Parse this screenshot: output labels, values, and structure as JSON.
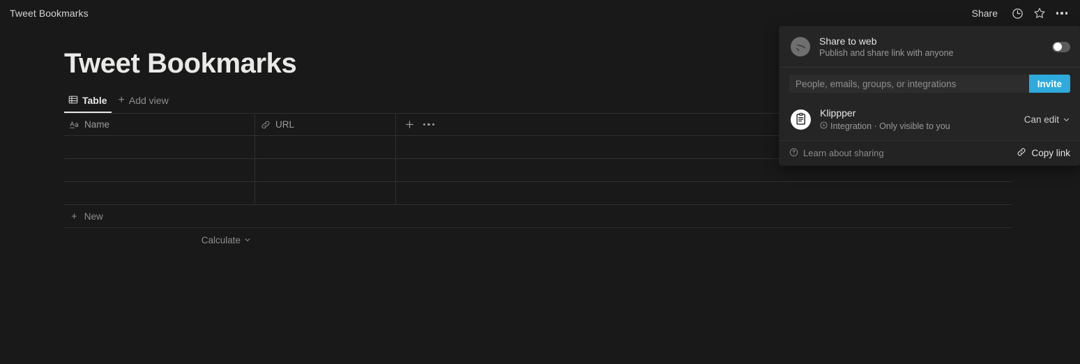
{
  "topbar": {
    "breadcrumb": "Tweet Bookmarks",
    "share_label": "Share",
    "history_icon": "clock-icon",
    "favorite_icon": "star-icon",
    "more_icon": "ellipsis-icon"
  },
  "page": {
    "title": "Tweet Bookmarks",
    "tabs": [
      {
        "label": "Table",
        "icon": "table-icon",
        "active": true
      },
      {
        "label": "Add view",
        "icon": "plus-icon",
        "active": false
      }
    ]
  },
  "table": {
    "columns": [
      {
        "label": "Name",
        "icon": "text-type-icon"
      },
      {
        "label": "URL",
        "icon": "link-type-icon"
      }
    ],
    "add_column_label": "+",
    "more_columns_label": "···",
    "rows": [
      {
        "name": "",
        "url": ""
      },
      {
        "name": "",
        "url": ""
      },
      {
        "name": "",
        "url": ""
      }
    ],
    "new_row_label": "New",
    "calculate_label": "Calculate"
  },
  "share_popup": {
    "share_to_web": {
      "icon": "globe-icon",
      "title": "Share to web",
      "subtitle": "Publish and share link with anyone",
      "toggle_on": false
    },
    "invite": {
      "placeholder": "People, emails, groups, or integrations",
      "value": "",
      "button_label": "Invite"
    },
    "members": [
      {
        "avatar_icon": "clipboard-icon",
        "name": "Klippper",
        "meta": "Integration · Only visible to you",
        "meta_icon": "bolt-circle-icon",
        "permission": "Can edit"
      }
    ],
    "footer": {
      "learn_icon": "question-circle-icon",
      "learn_label": "Learn about sharing",
      "copy_icon": "link-icon",
      "copy_label": "Copy link"
    }
  },
  "colors": {
    "background": "#191919",
    "popup_background": "#252525",
    "accent_blue": "#2eaadc",
    "border": "#2f2f2f",
    "text_primary": "#e6e6e5",
    "text_muted": "#8d8d8b"
  }
}
